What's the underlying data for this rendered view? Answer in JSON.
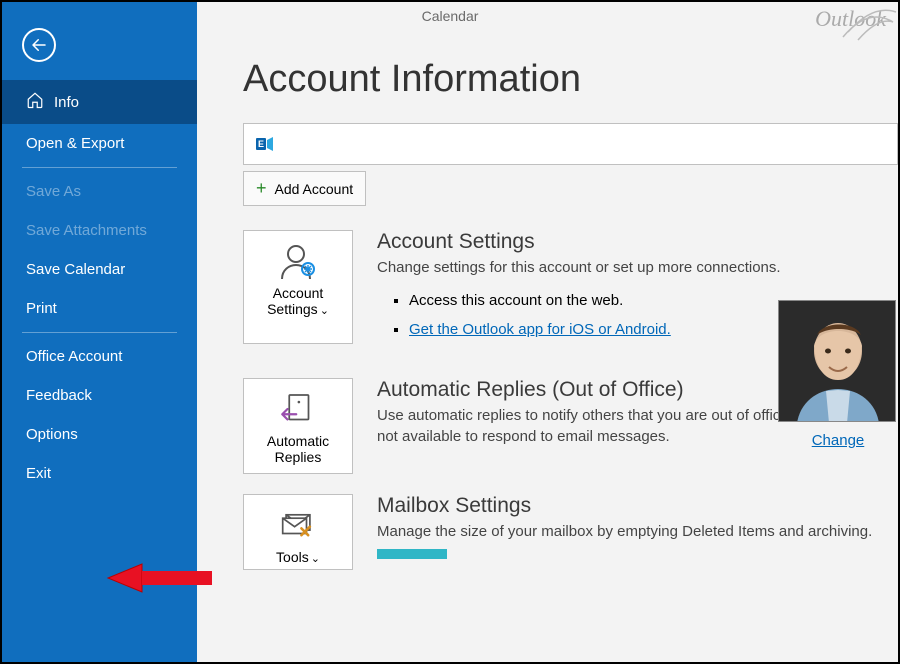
{
  "header": {
    "context": "Calendar",
    "app": "Outlook"
  },
  "sidebar": {
    "items": [
      {
        "label": "Info"
      },
      {
        "label": "Open & Export"
      },
      {
        "label": "Save As"
      },
      {
        "label": "Save Attachments"
      },
      {
        "label": "Save Calendar"
      },
      {
        "label": "Print"
      },
      {
        "label": "Office Account"
      },
      {
        "label": "Feedback"
      },
      {
        "label": "Options"
      },
      {
        "label": "Exit"
      }
    ]
  },
  "main": {
    "title": "Account Information",
    "add_account": "Add Account",
    "avatar_change": "Change",
    "sections": {
      "account_settings": {
        "button": "Account Settings",
        "title": "Account Settings",
        "desc": "Change settings for this account or set up more connections.",
        "bullet1": "Access this account on the web.",
        "bullet2": "Get the Outlook app for iOS or Android."
      },
      "auto_replies": {
        "button": "Automatic Replies",
        "title": "Automatic Replies (Out of Office)",
        "desc": "Use automatic replies to notify others that you are out of office, on vacation, or not available to respond to email messages."
      },
      "mailbox": {
        "button": "Tools",
        "title": "Mailbox Settings",
        "desc": "Manage the size of your mailbox by emptying Deleted Items and archiving."
      }
    }
  }
}
